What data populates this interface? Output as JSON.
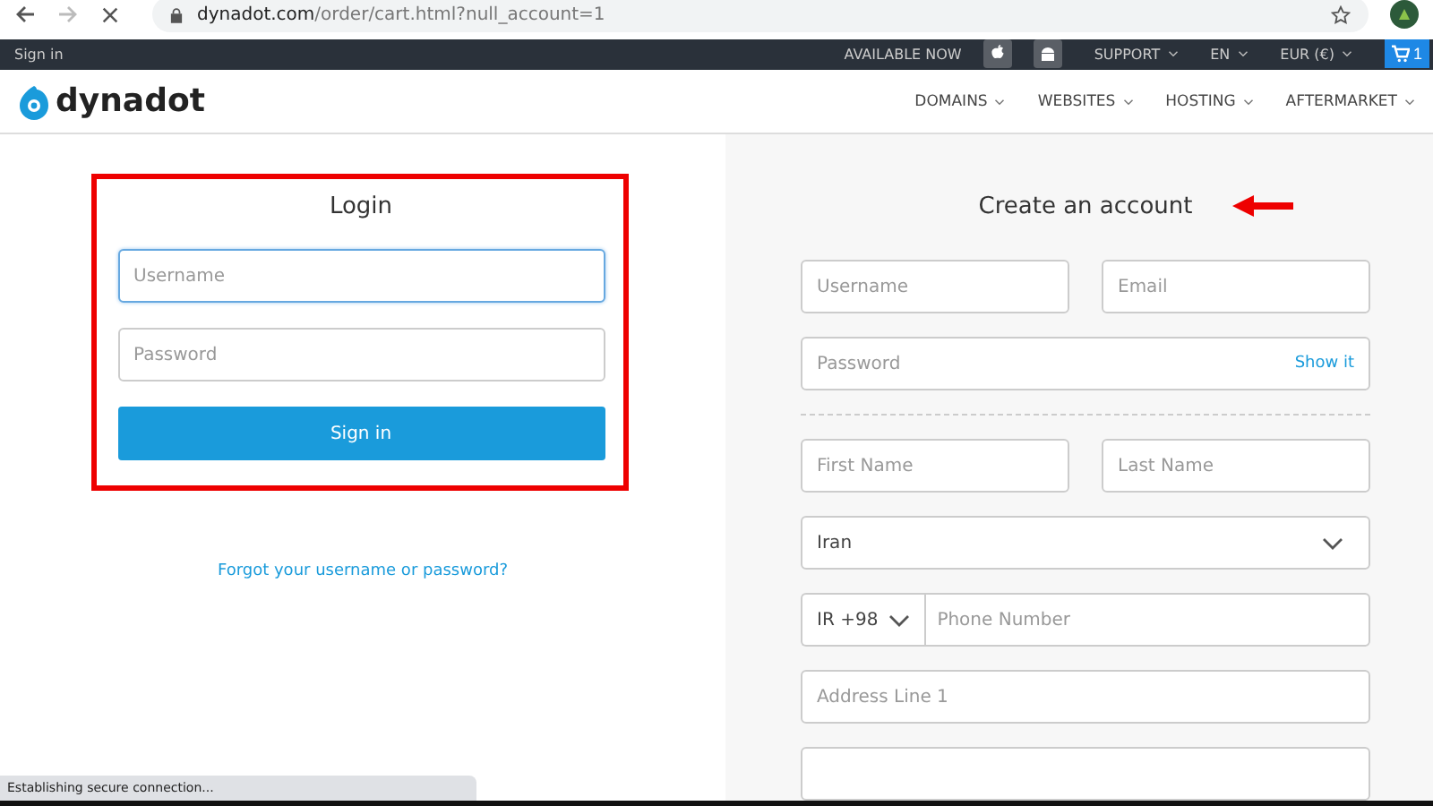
{
  "browser": {
    "url_host": "dynadot.com",
    "url_path": "/order/cart.html?null_account=1",
    "status": "Establishing secure connection..."
  },
  "topbar": {
    "sign_in": "Sign in",
    "available": "AVAILABLE NOW",
    "menus": [
      "SUPPORT",
      "EN",
      "EUR (€)"
    ],
    "cart_count": "1"
  },
  "header": {
    "logo": "dynadot",
    "nav": [
      "DOMAINS",
      "WEBSITES",
      "HOSTING",
      "AFTERMARKET"
    ]
  },
  "login": {
    "title": "Login",
    "fields": [
      {
        "placeholder": "Username",
        "focused": true
      },
      {
        "placeholder": "Password",
        "focused": false
      }
    ],
    "button": "Sign in",
    "forgot": "Forgot your username or password?"
  },
  "signup": {
    "title": "Create an account",
    "username": {
      "placeholder": "Username"
    },
    "email": {
      "placeholder": "Email"
    },
    "password": {
      "placeholder": "Password"
    },
    "show": "Show it",
    "first_name": {
      "placeholder": "First Name"
    },
    "last_name": {
      "placeholder": "Last Name"
    },
    "country": "Iran",
    "phone_code": "IR +98",
    "phone": {
      "placeholder": "Phone Number"
    },
    "address": {
      "placeholder": "Address Line 1"
    }
  }
}
